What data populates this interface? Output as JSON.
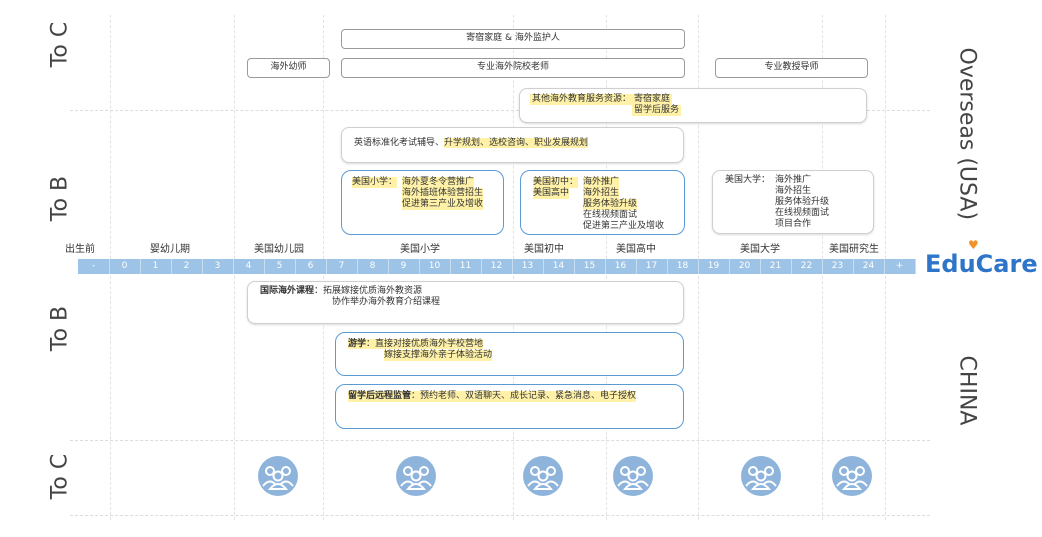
{
  "side": {
    "to_c_top": "To C",
    "to_b_top": "To B",
    "to_b_bottom": "To B",
    "to_c_bottom": "To C",
    "overseas": "Overseas (USA)",
    "china": "CHINA"
  },
  "boxes": {
    "homestay": "寄宿家庭 & 海外监护人",
    "kinder_teacher": "海外幼师",
    "school_teacher": "专业海外院校老师",
    "professor": "专业教授导师",
    "other_services_label": "其他海外教育服务资源：",
    "other_services_1": "寄宿家庭",
    "other_services_2": "留学后服务",
    "english_prefix": "英语标准化考试辅导、",
    "english_highlight": "升学规划、选校咨询、职业发展规划"
  },
  "to_b_overseas": {
    "primary_label": "美国小学：",
    "primary_lines": [
      "海外夏冬令营推广",
      "海外插班体验营招生",
      "促进第三产业及增收"
    ],
    "middle_label1": "美国初中：",
    "middle_label2": "美国高中",
    "middle_lines_hl": [
      "海外推广",
      "海外招生",
      "服务体验升级"
    ],
    "middle_lines": [
      "在线视频面试",
      "促进第三产业及增收"
    ],
    "univ_label": "美国大学：",
    "univ_lines": [
      "海外推广",
      "海外招生",
      "服务体验升级",
      "在线视频面试",
      "项目合作"
    ]
  },
  "stages": [
    "出生前",
    "婴幼儿期",
    "美国幼儿园",
    "美国小学",
    "美国初中",
    "美国高中",
    "美国大学",
    "美国研究生"
  ],
  "ticks": [
    "-",
    "0",
    "1",
    "2",
    "3",
    "4",
    "5",
    "6",
    "7",
    "8",
    "9",
    "10",
    "11",
    "12",
    "13",
    "14",
    "15",
    "16",
    "17",
    "18",
    "19",
    "20",
    "21",
    "22",
    "23",
    "24",
    "+"
  ],
  "logo": {
    "edu": "Edu",
    "care": "Care"
  },
  "china_b": {
    "intl_label": "国际海外课程",
    "intl_line1": "：拓展嫁接优质海外教资源",
    "intl_line2": "协作举办海外教育介绍课程",
    "tour_label": "游学",
    "tour_line1": "：直接对接优质海外学校营地",
    "tour_line2": "嫁接支撑海外亲子体验活动",
    "supervise_label": "留学后远程监管",
    "supervise_line": "：预约老师、双语聊天、成长记录、紧急消息、电子授权"
  },
  "colors": {
    "timeline": "#9dc3e6",
    "accent_blue": "#5b9bd5",
    "highlight": "#fff2a8",
    "avatar": "#8eb4dc",
    "logo_orange": "#f0932b"
  },
  "icons": [
    "group-people-icon",
    "group-people-icon",
    "group-people-icon",
    "group-people-icon",
    "group-people-icon",
    "group-people-icon"
  ]
}
